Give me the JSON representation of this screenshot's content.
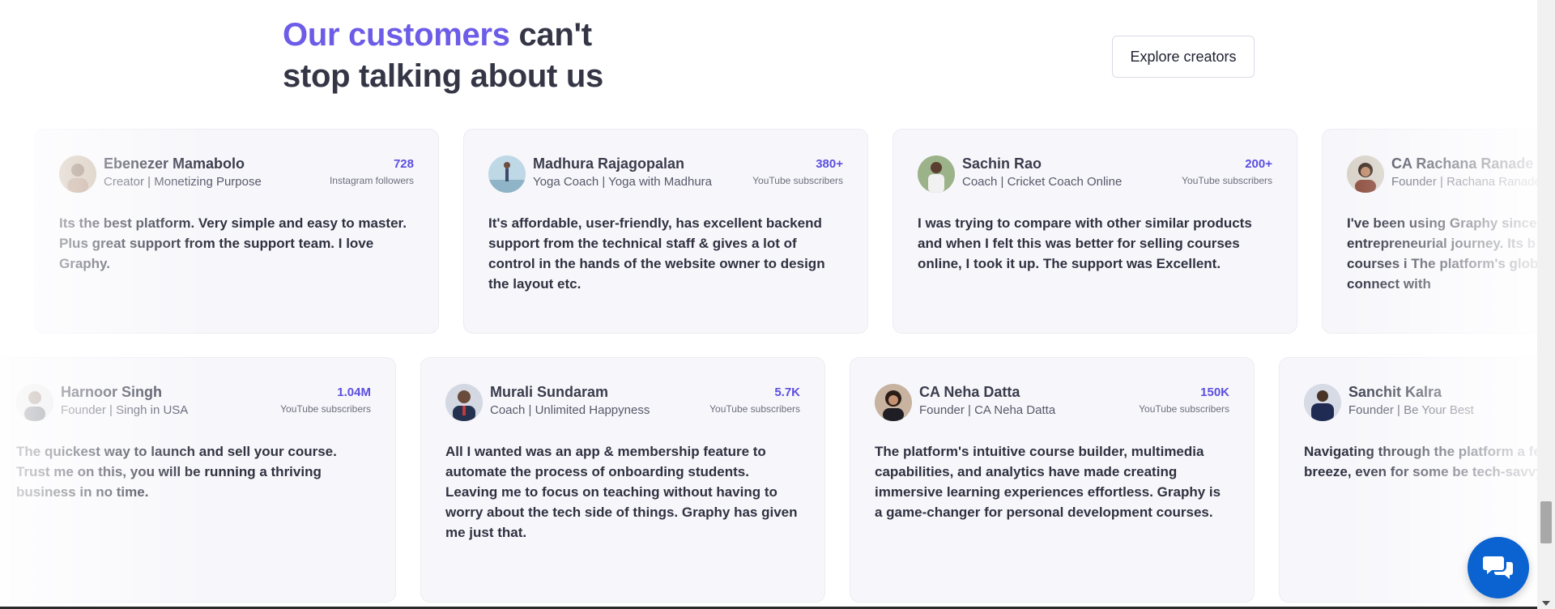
{
  "header": {
    "title_accent": "Our customers",
    "title_line1_rest": "can't",
    "title_line2": "stop talking about us",
    "explore_label": "Explore creators"
  },
  "row1": [
    {
      "name": "Ebenezer Mamabolo",
      "role": "Creator | Monetizing Purpose",
      "stat_value": "728",
      "stat_label": "Instagram followers",
      "quote": "Its the best platform. Very simple and easy to master. Plus great support from the support team. I love Graphy."
    },
    {
      "name": "Madhura Rajagopalan",
      "role": "Yoga Coach | Yoga with Madhura",
      "stat_value": "380+",
      "stat_label": "YouTube subscribers",
      "quote": "It's affordable, user-friendly, has excellent backend support from the technical staff & gives a lot of control in the hands of the website owner to design the layout etc."
    },
    {
      "name": "Sachin Rao",
      "role": "Coach | Cricket Coach Online",
      "stat_value": "200+",
      "stat_label": "YouTube subscribers",
      "quote": "I was trying to compare with other similar products and when I felt this was better for selling courses online, I took it up. The support was Excellent."
    },
    {
      "name": "CA Rachana Ranade",
      "role": "Founder | Rachana Ranade",
      "stat_value": "",
      "stat_label": "",
      "quote": "I've been using Graphy since the start of my entrepreneurial journey. Its b I'm able to offer my courses i The platform's global payme enabled me to connect with"
    }
  ],
  "row2": [
    {
      "name": "Harnoor Singh",
      "role": "Founder | Singh in USA",
      "stat_value": "1.04M",
      "stat_label": "YouTube subscribers",
      "quote": "The quickest way to launch and sell your course. Trust me on this, you will be running a thriving business in no time."
    },
    {
      "name": "Murali Sundaram",
      "role": "Coach | Unlimited Happyness",
      "stat_value": "5.7K",
      "stat_label": "YouTube subscribers",
      "quote": "All I wanted was an app & membership feature to automate the process of onboarding students. Leaving me to focus on teaching without having to worry about the tech side of things. Graphy has given me just that."
    },
    {
      "name": "CA Neha Datta",
      "role": "Founder | CA Neha Datta",
      "stat_value": "150K",
      "stat_label": "YouTube subscribers",
      "quote": "The platform's intuitive course builder, multimedia capabilities, and analytics have made creating immersive learning experiences effortless. Graphy is a game-changer for personal development courses."
    },
    {
      "name": "Sanchit Kalra",
      "role": "Founder | Be Your Best",
      "stat_value": "",
      "stat_label": "",
      "quote": "Navigating through the platform a features is a breeze, even for some be tech-savvy."
    }
  ],
  "colors": {
    "accent": "#6c5ce7",
    "stat": "#5b4fe0",
    "chat": "#0b63d1"
  },
  "icons": {
    "chat": "chat-bubbles-icon"
  }
}
